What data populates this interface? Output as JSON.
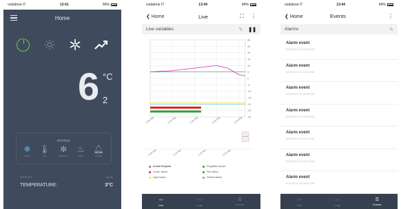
{
  "phone1": {
    "status": {
      "carrier": "vodafone IT",
      "time": "13:41",
      "battery": "84%"
    },
    "header": {
      "title": "Home"
    },
    "icons": [
      "power-icon",
      "sun-icon",
      "snowflake-fan-icon",
      "trend-up-icon"
    ],
    "temperature": {
      "integer": "6",
      "decimal": "2",
      "unit": "°C"
    },
    "status_card": {
      "label": "STATUS",
      "items": [
        {
          "icon": "snowflake-icon",
          "label": "COOL",
          "active": true
        },
        {
          "icon": "thermometer-icon",
          "label": "SET",
          "active": false
        },
        {
          "icon": "fan-icon",
          "label": "DEFROST",
          "active": false
        },
        {
          "icon": "fire-icon",
          "label": "HEAT",
          "active": false
        },
        {
          "icon": "bell-icon",
          "label": "ALARM",
          "active": false
        }
      ]
    },
    "setpoint_label": "SETPOINT",
    "value_label": "VALUE",
    "temperature_label": "TEMPERATURE:",
    "temperature_value": "3°C"
  },
  "phone2": {
    "status": {
      "carrier": "vodafone IT",
      "time": "13:44",
      "battery": "84%"
    },
    "header": {
      "back": "Home",
      "title": "Live"
    },
    "section": {
      "title": "Live variables"
    },
    "legend": [
      {
        "label": "Actual Setpoint",
        "color": "#e040c8"
      },
      {
        "label": "Regulation probe",
        "color": "#2e9e3a"
      },
      {
        "label": "Comp. status",
        "color": "#e02020"
      },
      {
        "label": "Fan status",
        "color": "#2e9e3a"
      },
      {
        "label": "Light status",
        "color": "#e8e040"
      },
      {
        "label": "Defrost status",
        "color": "#40b8e0"
      }
    ],
    "tabs": [
      {
        "label": "Live",
        "icon": "trend-icon",
        "active": true
      },
      {
        "label": "Logs",
        "icon": "logs-icon",
        "active": false
      },
      {
        "label": "Events",
        "icon": "list-icon",
        "active": false
      }
    ]
  },
  "chart_data": {
    "type": "line",
    "y_ticks": [
      "30",
      "25",
      "20",
      "15",
      "10",
      "5",
      "0",
      "-5",
      "-10",
      "-15",
      "-20",
      "-25",
      "-30"
    ],
    "ylim": [
      -30,
      30
    ],
    "x_ticks": [
      "1:40 PM",
      "1:41 PM",
      "1:42 PM",
      "1:43 PM",
      "1:44 PM"
    ],
    "overview_x_ticks": [
      "1:05 PM",
      "1:10 PM",
      "1:15 PM",
      "1:20 PM"
    ],
    "series": [
      {
        "name": "Actual Setpoint",
        "color": "#e040c8",
        "x": [
          0,
          1,
          2,
          3,
          3.5,
          4,
          4.3
        ],
        "y": [
          5,
          6,
          8,
          10,
          8,
          3,
          2
        ]
      },
      {
        "name": "Regulation probe",
        "color": "#2e9e3a",
        "x": [
          0,
          4.3
        ],
        "y": [
          5,
          5
        ]
      },
      {
        "name": "Light status",
        "color": "#e8e040",
        "x": [
          0,
          4.3
        ],
        "y": [
          -19,
          -19
        ]
      },
      {
        "name": "Defrost status",
        "color": "#40b8e0",
        "x": [
          0,
          4.3
        ],
        "y": [
          -20,
          -20
        ]
      }
    ],
    "comp_status_span": [
      0,
      2.3
    ],
    "fan_status_span": [
      0,
      2.3
    ]
  },
  "phone3": {
    "status": {
      "carrier": "vodafone IT",
      "time": "13:44",
      "battery": "84%"
    },
    "header": {
      "back": "Home",
      "title": "Events"
    },
    "section": {
      "title": "Alarms"
    },
    "events": [
      {
        "title": "Alarm event",
        "date": "9/23/2022 10:42:45 AM"
      },
      {
        "title": "Alarm event",
        "date": "9/23/2022 10:42:23 AM"
      },
      {
        "title": "Alarm event",
        "date": "9/23/2022 10:39:25 AM"
      },
      {
        "title": "Alarm event",
        "date": "9/23/2022 10:39:20 AM"
      },
      {
        "title": "Alarm event",
        "date": "9/23/2022 10:39:17 AM"
      },
      {
        "title": "Alarm event",
        "date": "9/23/2022 10:39:13 AM"
      },
      {
        "title": "Alarm event",
        "date": "9/23/2022 10:39:06 AM"
      }
    ],
    "tabs": [
      {
        "label": "Live",
        "icon": "trend-icon",
        "active": false
      },
      {
        "label": "Logs",
        "icon": "logs-icon",
        "active": false
      },
      {
        "label": "Events",
        "icon": "list-icon",
        "active": true
      }
    ]
  }
}
